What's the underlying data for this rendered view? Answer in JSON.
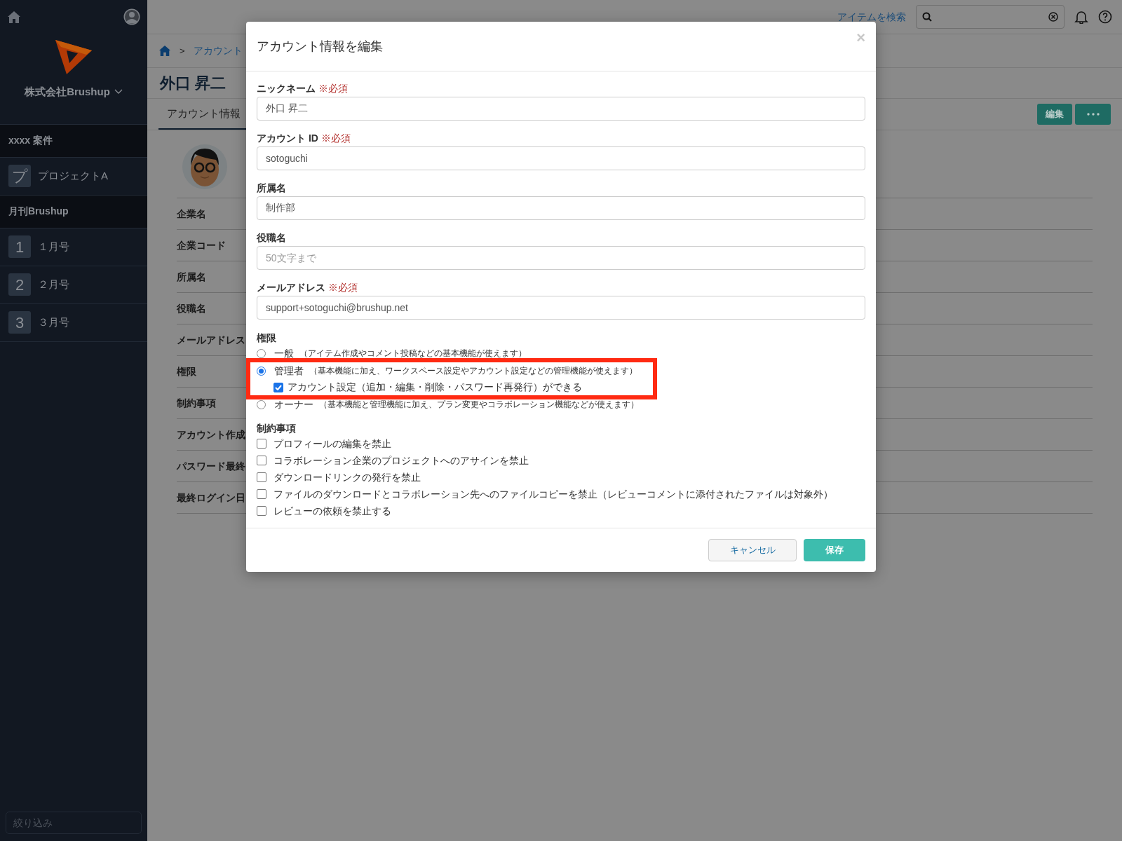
{
  "sidebar": {
    "workspace": "株式会社Brushup",
    "sections": [
      {
        "title": "xxxx 案件",
        "items": [
          {
            "badge": "プ",
            "label": "プロジェクトA"
          }
        ]
      },
      {
        "title": "月刊Brushup",
        "items": [
          {
            "badge": "1",
            "label": "１月号"
          },
          {
            "badge": "2",
            "label": "２月号"
          },
          {
            "badge": "3",
            "label": "３月号"
          }
        ]
      }
    ],
    "filter": {
      "placeholder": "絞り込み"
    }
  },
  "topbar": {
    "search_link": "アイテムを検索"
  },
  "page": {
    "breadcrumb_separator": ">",
    "breadcrumb": "アカウント",
    "title": "外口 昇二",
    "tabs": [
      {
        "label": "アカウント情報",
        "selected": true
      }
    ],
    "edit_button": "編集",
    "fields": [
      "企業名",
      "企業コード",
      "所属名",
      "役職名",
      "メールアドレス",
      "権限",
      "制約事項",
      "アカウント作成",
      "パスワード最終",
      "最終ログイン日"
    ]
  },
  "dialog": {
    "title": "アカウント情報を編集",
    "close": "×",
    "fields": [
      {
        "label": "ニックネーム",
        "required": "※必須",
        "value": "外口 昇二"
      },
      {
        "label": "アカウント ID",
        "required": "※必須",
        "value": "sotoguchi"
      },
      {
        "label": "所属名",
        "value": "制作部"
      },
      {
        "label": "役職名",
        "placeholder": "50文字まで"
      },
      {
        "label": "メールアドレス",
        "required": "※必須",
        "value": "support+sotoguchi@brushup.net"
      }
    ],
    "permission": {
      "title": "権限",
      "options": [
        {
          "label": "一般",
          "note": "（アイテム作成やコメント投稿などの基本機能が使えます）",
          "selected": false,
          "highlighted": false
        },
        {
          "label": "管理者",
          "note": "（基本機能に加え、ワークスペース設定やアカウント設定などの管理機能が使えます）",
          "selected": true,
          "highlighted": true,
          "sub": {
            "label": "アカウント設定（追加・編集・削除・パスワード再発行）ができる",
            "checked": true
          }
        },
        {
          "label": "オーナー",
          "note": "（基本機能と管理機能に加え、プラン変更やコラボレーション機能などが使えます）",
          "selected": false,
          "highlighted": false
        }
      ]
    },
    "restrictions": {
      "title": "制約事項",
      "items": [
        {
          "label": "プロフィールの編集を禁止",
          "checked": false
        },
        {
          "label": "コラボレーション企業のプロジェクトへのアサインを禁止",
          "checked": false
        },
        {
          "label": "ダウンロードリンクの発行を禁止",
          "checked": false
        },
        {
          "label": "ファイルのダウンロードとコラボレーション先へのファイルコピーを禁止（レビューコメントに添付されたファイルは対象外）",
          "checked": false
        },
        {
          "label": "レビューの依頼を禁止する",
          "checked": false
        }
      ]
    },
    "buttons": [
      {
        "kind": "secondary",
        "label": "キャンセル"
      },
      {
        "kind": "primary",
        "label": "保存"
      }
    ]
  }
}
